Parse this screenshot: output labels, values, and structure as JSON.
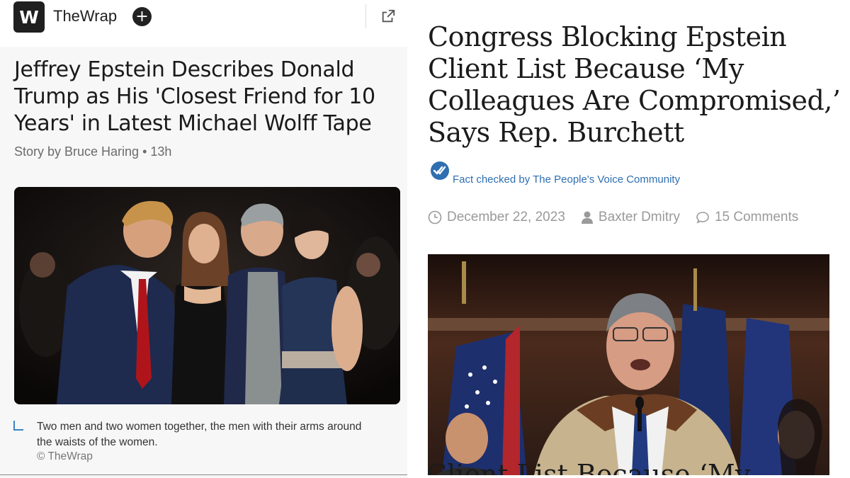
{
  "left_article": {
    "logo_letter": "W",
    "publisher": "TheWrap",
    "follow_symbol": "+",
    "title": "Jeffrey Epstein Describes Donald Trump as His 'Closest Friend for 10 Years' in Latest Michael Wolff Tape",
    "byline": "Story by Bruce Haring • 13h",
    "caption": "Two men and two women together, the men with their arms around the waists of the women.",
    "credit": "© TheWrap"
  },
  "right_article": {
    "title": "Congress Blocking Epstein Client List Because ‘My Colleagues Are Compromised,’ Says Rep. Burchett",
    "fact_check": "Fact checked by The People's Voice Community",
    "date": "December 22, 2023",
    "author": "Baxter Dmitry",
    "comments": "15 Comments",
    "cut_off_text": "Client List Because ‘My"
  },
  "colors": {
    "accent_blue": "#2f6eb0",
    "caption_marker": "#3b82c4",
    "meta_gray": "#9a9a9a"
  },
  "icons": {
    "left": [
      "follow-plus-icon",
      "external-link-icon",
      "caption-corner-icon"
    ],
    "right": [
      "fact-check-badge-icon",
      "clock-icon",
      "user-icon",
      "comment-icon"
    ]
  }
}
